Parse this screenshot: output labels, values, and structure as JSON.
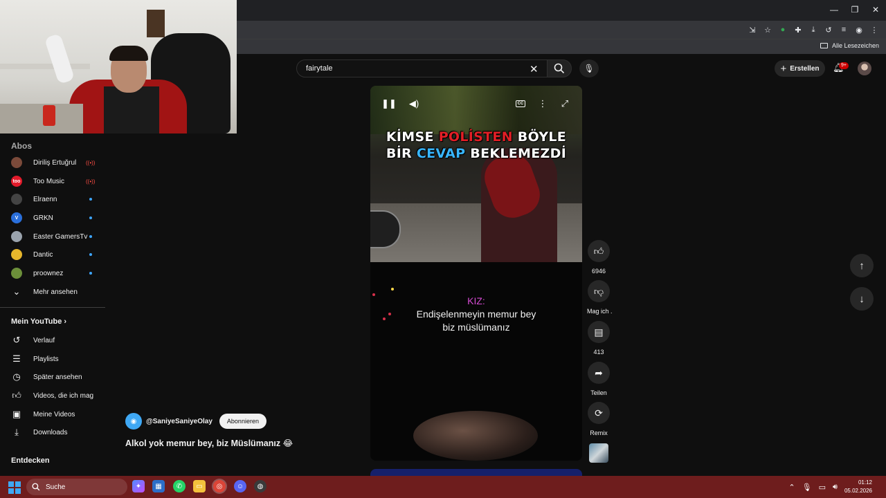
{
  "browser": {
    "bookmarks_label": "Alle Lesezeichen"
  },
  "search": {
    "query": "fairytale"
  },
  "header": {
    "create_label": "Erstellen",
    "notifications_badge": "9+"
  },
  "sidebar": {
    "section_label": "Abos",
    "channels": [
      {
        "name": "Diriliş Ertuğrul",
        "live": true,
        "avatar_text": "",
        "color": "#7b4a3a"
      },
      {
        "name": "Too Music",
        "live": true,
        "avatar_text": "too",
        "color": "#e21b2b"
      },
      {
        "name": "Elraenn",
        "live": false,
        "avatar_text": "",
        "color": "#444"
      },
      {
        "name": "GRKN",
        "live": false,
        "avatar_text": "V",
        "color": "#2a6fdb"
      },
      {
        "name": "Easter GamersTv",
        "live": false,
        "avatar_text": "",
        "color": "#9aa3ad"
      },
      {
        "name": "Dantic",
        "live": false,
        "avatar_text": "",
        "color": "#e6b62c"
      },
      {
        "name": "proownez",
        "live": false,
        "avatar_text": "",
        "color": "#6c8f3a"
      }
    ],
    "more_label": "Mehr ansehen",
    "my_youtube_label": "Mein YouTube",
    "my_items": [
      {
        "label": "Verlauf",
        "icon": "history-icon"
      },
      {
        "label": "Playlists",
        "icon": "playlists-icon"
      },
      {
        "label": "Später ansehen",
        "icon": "watch-later-icon"
      },
      {
        "label": "Videos, die ich mag",
        "icon": "liked-videos-icon"
      },
      {
        "label": "Meine Videos",
        "icon": "my-videos-icon"
      },
      {
        "label": "Downloads",
        "icon": "downloads-icon"
      }
    ],
    "explore_label": "Entdecken"
  },
  "short": {
    "caption_line1_a": "KİMSE ",
    "caption_line1_b": "POLİSTEN",
    "caption_line1_c": " BÖYLE",
    "caption_line2_a": "BİR ",
    "caption_line2_b": "CEVAP",
    "caption_line2_c": " BEKLEMEZDİ",
    "subtitle_speaker": "KIZ:",
    "subtitle_line1": "Endişelenmeyin memur bey",
    "subtitle_line2": "biz müslümanız",
    "channel_handle": "@SaniyeSaniyeOlay",
    "subscribe_label": "Abonnieren",
    "title": "Alkol yok memur bey, biz Müslümanız 😂"
  },
  "actions": {
    "likes": "6946",
    "dislike_label": "Mag ich .",
    "comments": "413",
    "share_label": "Teilen",
    "remix_label": "Remix"
  },
  "taskbar": {
    "search_placeholder": "Suche",
    "time": "01:12",
    "date": "05.02.2026"
  },
  "colors": {
    "accent_red": "#e21f26",
    "accent_blue": "#38b6ff",
    "speaker_purple": "#d54bd2",
    "taskbar": "#6e1d1d"
  }
}
